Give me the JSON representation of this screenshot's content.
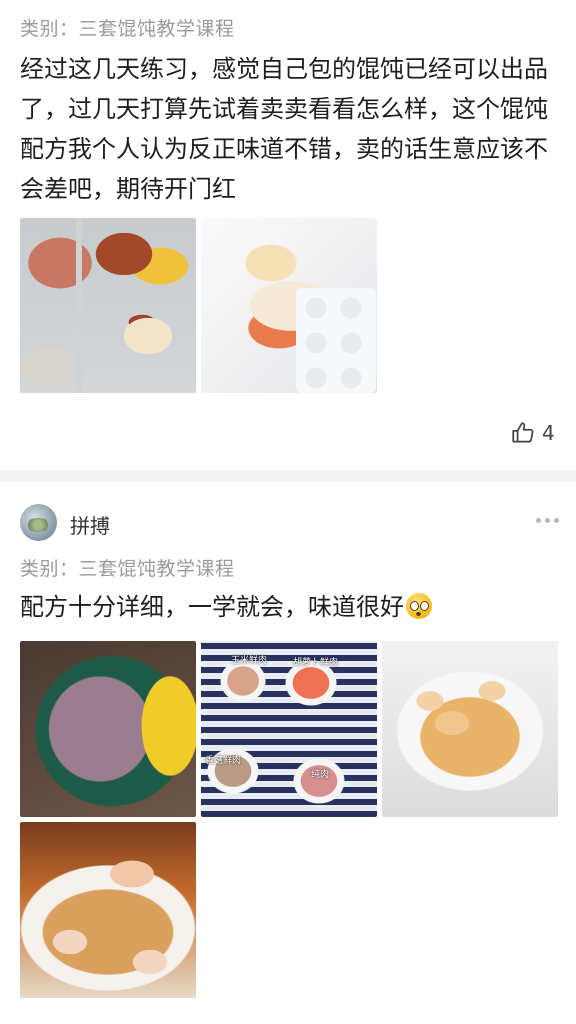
{
  "posts": [
    {
      "category": "类别：三套馄饨教学课程",
      "content": "经过这几天练习，感觉自己包的馄饨已经可以出品了，过几天打算先试着卖卖看看怎么样，这个馄饨配方我个人认为反正味道不错，卖的话生意应该不会差吧，期待开门红",
      "like_count": "4"
    },
    {
      "username": "拼搏",
      "category": "类别：三套馄饨教学课程",
      "content": "配方十分详细，一学就会，味道很好",
      "image_labels": [
        "玉米鲜肉",
        "胡萝卜鲜肉",
        "香菇鲜肉",
        "纯肉"
      ]
    }
  ],
  "icons": {
    "like": "thumbs-up-icon",
    "more": "more-dots-icon",
    "emoji": "flushed-face-emoji"
  },
  "colors": {
    "category_text": "#9a9a9a",
    "divider": "#f2f2f2",
    "body_text": "#1e1e1e"
  }
}
